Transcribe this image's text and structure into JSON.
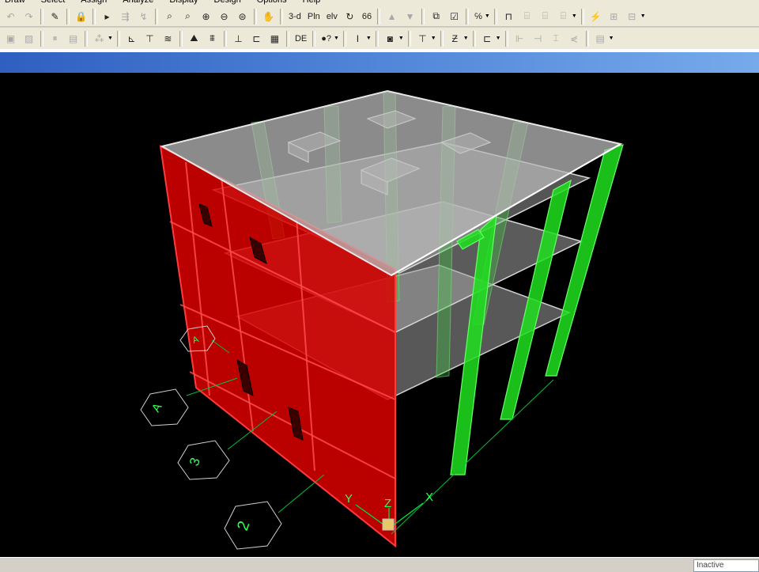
{
  "menu": [
    "Draw",
    "Select",
    "Assign",
    "Analyze",
    "Display",
    "Design",
    "Options",
    "Help"
  ],
  "toolbar1": [
    {
      "icon": "undo-icon",
      "glyph": "↶",
      "dim": true
    },
    {
      "icon": "redo-icon",
      "glyph": "↷",
      "dim": true
    },
    {
      "sep": true
    },
    {
      "icon": "pencil-icon",
      "glyph": "✎"
    },
    {
      "sep": true
    },
    {
      "icon": "lock-icon",
      "glyph": "🔒"
    },
    {
      "sep": true
    },
    {
      "icon": "run-icon",
      "glyph": "▸"
    },
    {
      "icon": "step-icon",
      "glyph": "⇶",
      "dim": true
    },
    {
      "icon": "rubber-band-icon",
      "glyph": "↯",
      "dim": true
    },
    {
      "sep": true
    },
    {
      "icon": "zoom-window-icon",
      "glyph": "⌕"
    },
    {
      "icon": "zoom-restore-icon",
      "glyph": "⌕"
    },
    {
      "icon": "zoom-in-icon",
      "glyph": "⊕"
    },
    {
      "icon": "zoom-out-icon",
      "glyph": "⊖"
    },
    {
      "icon": "zoom-full-icon",
      "glyph": "⊜"
    },
    {
      "sep": true
    },
    {
      "icon": "pan-icon",
      "glyph": "✋"
    },
    {
      "sep": true
    },
    {
      "icon": "view-3d-icon",
      "text": "3-d"
    },
    {
      "icon": "view-plan-icon",
      "text": "Pln"
    },
    {
      "icon": "view-elev-icon",
      "text": "elv"
    },
    {
      "icon": "rotate-icon",
      "glyph": "↻"
    },
    {
      "icon": "perspective-icon",
      "text": "66"
    },
    {
      "sep": true
    },
    {
      "icon": "move-up-icon",
      "glyph": "▲",
      "dim": true
    },
    {
      "icon": "move-down-icon",
      "glyph": "▼",
      "dim": true
    },
    {
      "sep": true
    },
    {
      "icon": "object-shrink-icon",
      "glyph": "⧉"
    },
    {
      "icon": "set-display-icon",
      "glyph": "☑"
    },
    {
      "sep": true
    },
    {
      "icon": "assign-icon",
      "text": "℅",
      "dropdown": true
    },
    {
      "sep": true
    },
    {
      "icon": "frame-icon",
      "glyph": "⊓"
    },
    {
      "icon": "frame2-icon",
      "glyph": "⌸",
      "dim": true
    },
    {
      "icon": "frame3-icon",
      "glyph": "⌸",
      "dim": true
    },
    {
      "icon": "frame4-icon",
      "glyph": "⌸",
      "dim": true,
      "dropdown": true
    },
    {
      "sep": true
    },
    {
      "icon": "lightning-icon",
      "glyph": "⚡",
      "dim": true
    },
    {
      "icon": "design-icon",
      "glyph": "⊞",
      "dim": true
    },
    {
      "icon": "design2-icon",
      "glyph": "⊟",
      "dim": true,
      "dropdown": true
    }
  ],
  "toolbar2": [
    {
      "icon": "show-all-icon",
      "glyph": "▣",
      "dim": true
    },
    {
      "icon": "show-grid-icon",
      "glyph": "▨",
      "dim": true
    },
    {
      "sep": true
    },
    {
      "icon": "columns-icon",
      "glyph": "⏸",
      "dim": true
    },
    {
      "icon": "beams-icon",
      "glyph": "▤",
      "dim": true
    },
    {
      "sep": true
    },
    {
      "icon": "snap-icon",
      "glyph": "⁂",
      "dim": true,
      "dropdown": true
    },
    {
      "sep": true
    },
    {
      "icon": "axes-icon",
      "glyph": "⊾"
    },
    {
      "icon": "tree-icon",
      "glyph": "⊤"
    },
    {
      "icon": "layers-icon",
      "glyph": "≋"
    },
    {
      "sep": true
    },
    {
      "icon": "image-icon",
      "glyph": "⛰"
    },
    {
      "icon": "chart-icon",
      "glyph": "⩩"
    },
    {
      "sep": true
    },
    {
      "icon": "elev-label-icon",
      "glyph": "⊥"
    },
    {
      "icon": "wall-icon",
      "glyph": "⊏"
    },
    {
      "icon": "grid-icon",
      "glyph": "▦"
    },
    {
      "sep": true
    },
    {
      "icon": "define-label-icon",
      "text": "DE"
    },
    {
      "sep": true
    },
    {
      "icon": "help-cursor-icon",
      "text": "●?",
      "dropdown": true
    },
    {
      "sep": true
    },
    {
      "icon": "section-i-icon",
      "glyph": "I",
      "dropdown": true
    },
    {
      "sep": true
    },
    {
      "icon": "area-icon",
      "glyph": "◙",
      "dropdown": true
    },
    {
      "sep": true
    },
    {
      "icon": "column-t-icon",
      "glyph": "⊤",
      "dropdown": true
    },
    {
      "sep": true
    },
    {
      "icon": "beam-z-icon",
      "glyph": "Ƶ",
      "dropdown": true
    },
    {
      "sep": true
    },
    {
      "icon": "channel-icon",
      "glyph": "⊏",
      "dropdown": true
    },
    {
      "sep": true
    },
    {
      "icon": "brace1-icon",
      "glyph": "⊩",
      "dim": true
    },
    {
      "icon": "brace2-icon",
      "glyph": "⊣",
      "dim": true
    },
    {
      "icon": "brace3-icon",
      "glyph": "⌶",
      "dim": true
    },
    {
      "icon": "brace4-icon",
      "glyph": "⋞",
      "dim": true
    },
    {
      "sep": true
    },
    {
      "icon": "table-icon",
      "glyph": "▤",
      "dim": true,
      "dropdown": true
    }
  ],
  "grid_bubbles": [
    "A",
    "A",
    "3",
    "2"
  ],
  "axes": {
    "x": "X",
    "y": "Y",
    "z": "Z"
  },
  "status": {
    "text": "Inactive"
  },
  "colors": {
    "walls": "#dd0000",
    "columns": "#22e022",
    "slabs": "#b4b4b4",
    "grid": "#00e040",
    "titlebar": "#2f5fc0"
  }
}
